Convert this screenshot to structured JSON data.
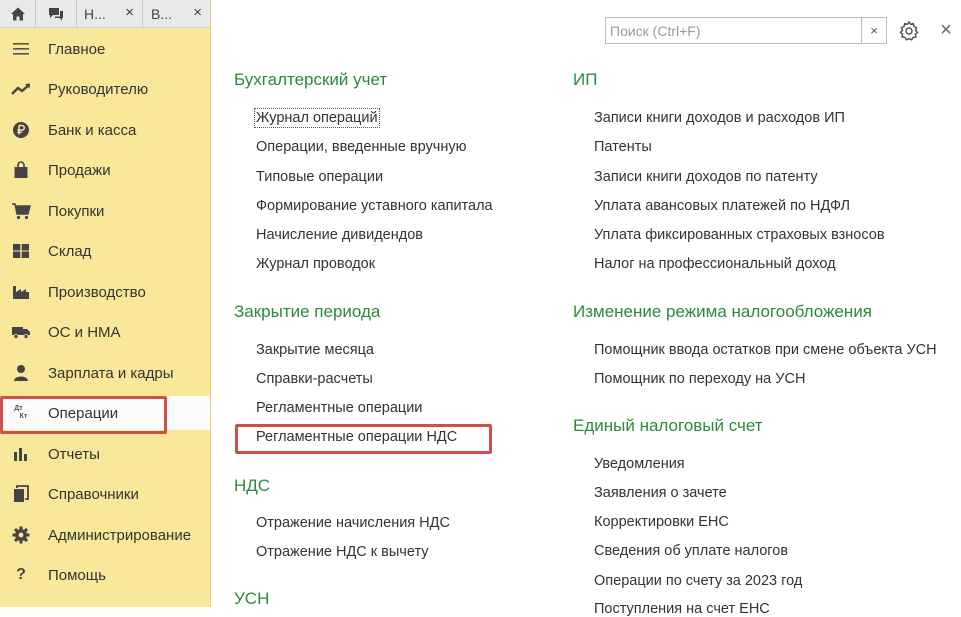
{
  "topbar": {
    "tabs": [
      {
        "label": "Н..."
      },
      {
        "label": "В..."
      }
    ],
    "close_glyph": "×"
  },
  "sidebar": {
    "items": [
      {
        "label": "Главное",
        "icon": "menu-lines-icon"
      },
      {
        "label": "Руководителю",
        "icon": "trend-up-icon"
      },
      {
        "label": "Банк и касса",
        "icon": "ruble-coin-icon"
      },
      {
        "label": "Продажи",
        "icon": "shopping-bag-icon"
      },
      {
        "label": "Покупки",
        "icon": "shopping-cart-icon"
      },
      {
        "label": "Склад",
        "icon": "warehouse-icon"
      },
      {
        "label": "Производство",
        "icon": "factory-icon"
      },
      {
        "label": "ОС и НМА",
        "icon": "truck-icon"
      },
      {
        "label": "Зарплата и кадры",
        "icon": "person-icon"
      },
      {
        "label": "Операции",
        "icon": "dt-kt-icon",
        "icon_text_top": "Дт",
        "icon_text_bottom": "Кт",
        "active": true
      },
      {
        "label": "Отчеты",
        "icon": "bar-chart-icon"
      },
      {
        "label": "Справочники",
        "icon": "books-icon"
      },
      {
        "label": "Администрирование",
        "icon": "gear-icon"
      },
      {
        "label": "Помощь",
        "icon": "question-icon",
        "icon_text": "?"
      }
    ]
  },
  "search": {
    "placeholder": "Поиск (Ctrl+F)",
    "value": "",
    "clear_glyph": "×"
  },
  "window": {
    "close_glyph": "×"
  },
  "colors": {
    "sidebar_bg": "#f9e89a",
    "group_title": "#2b8a3e",
    "highlight_box": "#cf4f4f"
  },
  "groups": {
    "accounting": {
      "title": "Бухгалтерский учет",
      "links": [
        "Журнал операций",
        "Операции, введенные вручную",
        "Типовые операции",
        "Формирование уставного капитала",
        "Начисление дивидендов",
        "Журнал проводок"
      ]
    },
    "period_close": {
      "title": "Закрытие периода",
      "links": [
        "Закрытие месяца",
        "Справки-расчеты",
        "Регламентные операции",
        "Регламентные операции НДС"
      ]
    },
    "vat": {
      "title": "НДС",
      "links": [
        "Отражение начисления НДС",
        "Отражение НДС к вычету"
      ]
    },
    "usn": {
      "title": "УСН"
    },
    "ip": {
      "title": "ИП",
      "links": [
        "Записи книги доходов и расходов ИП",
        "Патенты",
        "Записи книги доходов по патенту",
        "Уплата авансовых платежей по НДФЛ",
        "Уплата фиксированных страховых взносов",
        "Налог на профессиональный доход"
      ]
    },
    "tax_regime": {
      "title": "Изменение режима налогообложения",
      "links": [
        "Помощник ввода остатков при смене объекта УСН",
        "Помощник по переходу на УСН"
      ]
    },
    "ens": {
      "title": "Единый налоговый счет",
      "links": [
        "Уведомления",
        "Заявления о зачете",
        "Корректировки ЕНС",
        "Сведения об уплате налогов",
        "Операции по счету за 2023 год",
        "Поступления на счет ЕНС"
      ]
    }
  }
}
